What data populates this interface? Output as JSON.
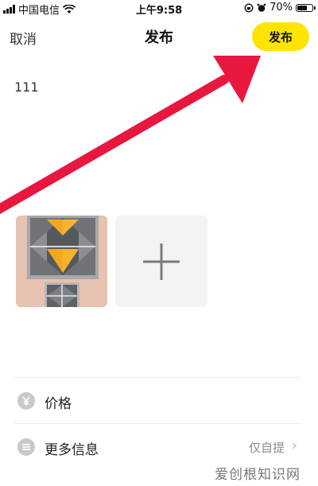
{
  "status_bar": {
    "carrier": "中国电信",
    "time": "上午9:58",
    "battery_text": "70%",
    "battery_level": 0.7
  },
  "nav": {
    "cancel_label": "取消",
    "title": "发布",
    "publish_label": "发布"
  },
  "post": {
    "text": "111"
  },
  "list": {
    "price_label": "价格",
    "more_info_label": "更多信息",
    "more_info_value": "仅自提"
  },
  "watermark": "爱创根知识网",
  "colors": {
    "accent": "#ffe400",
    "annotation_arrow": "#e8173f"
  },
  "icons": [
    "wifi-icon",
    "lock-rotation-icon",
    "alarm-icon",
    "battery-icon",
    "plus-icon",
    "yen-icon",
    "list-icon",
    "chevron-right-icon"
  ]
}
